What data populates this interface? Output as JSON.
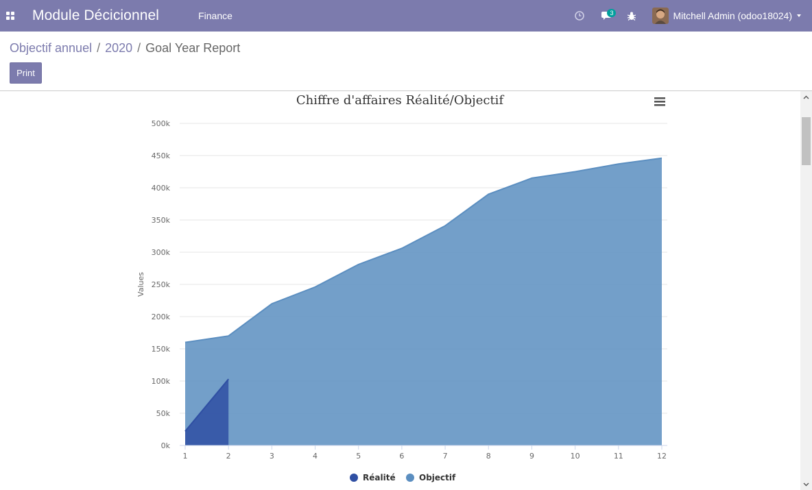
{
  "navbar": {
    "brand": "Module Décicionnel",
    "menu_finance": "Finance",
    "chat_count": "3",
    "user_name": "Mitchell Admin (odoo18024)",
    "color": "#7c7bad"
  },
  "breadcrumb": {
    "items": [
      "Objectif annuel",
      "2020"
    ],
    "separator": "/",
    "active": "Goal Year Report"
  },
  "actions": {
    "print_label": "Print"
  },
  "icons": [
    "apps-icon",
    "clock-icon",
    "chat-icon",
    "bug-icon",
    "avatar",
    "chevron-down-icon",
    "hamburger-menu-icon"
  ],
  "chart_data": {
    "type": "area",
    "title": "Chiffre d'affaires Réalité/Objectif",
    "ylabel": "Values",
    "xlabel": "",
    "categories": [
      "1",
      "2",
      "3",
      "4",
      "5",
      "6",
      "7",
      "8",
      "9",
      "10",
      "11",
      "12"
    ],
    "yticks": [
      "0k",
      "50k",
      "100k",
      "150k",
      "200k",
      "250k",
      "300k",
      "350k",
      "400k",
      "450k",
      "500k"
    ],
    "ylim": [
      0,
      500000
    ],
    "grid": true,
    "legend_position": "bottom-center",
    "series": [
      {
        "name": "Objectif",
        "color": "#5b8ec0",
        "values": [
          160000,
          170000,
          220000,
          246000,
          281000,
          306000,
          341000,
          390000,
          415000,
          425000,
          437000,
          446000
        ]
      },
      {
        "name": "Réalité",
        "color": "#2f4fa3",
        "values": [
          22000,
          103000,
          null,
          null,
          null,
          null,
          null,
          null,
          null,
          null,
          null,
          null
        ]
      }
    ],
    "legend": [
      "Réalité",
      "Objectif"
    ]
  }
}
